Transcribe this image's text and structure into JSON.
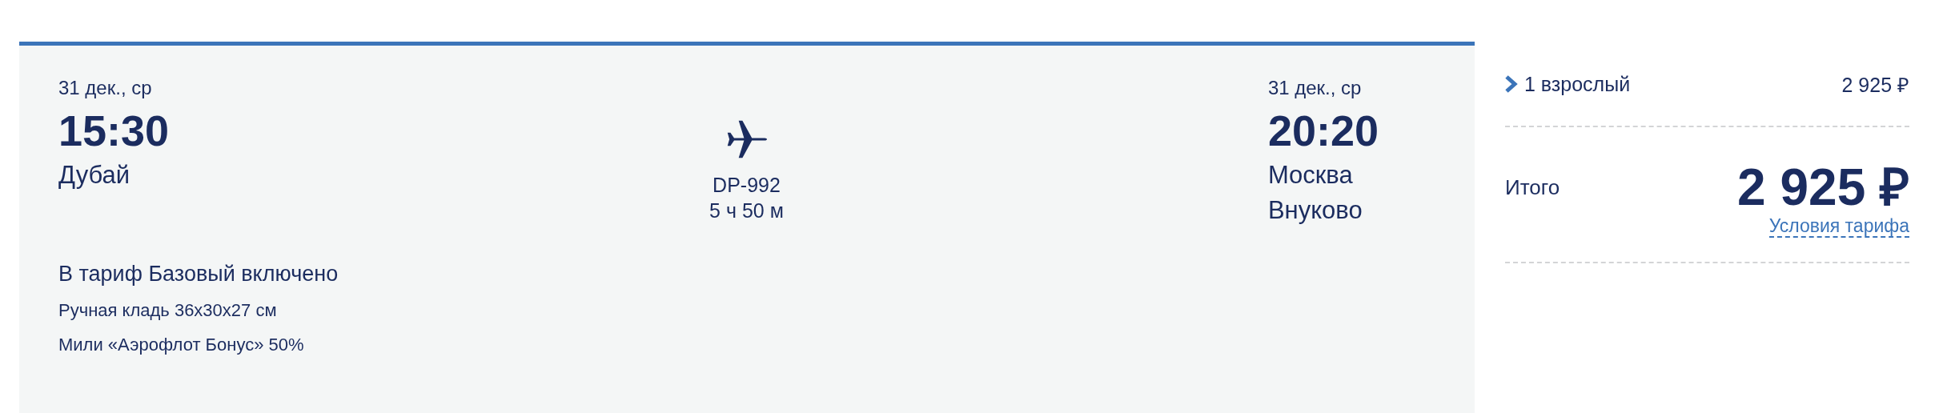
{
  "flight": {
    "departure": {
      "date": "31 дек., ср",
      "time": "15:30",
      "city": "Дубай"
    },
    "arrival": {
      "date": "31 дек., ср",
      "time": "20:20",
      "city": "Москва",
      "airport": "Внуково"
    },
    "flight_number": "DP-992",
    "duration": "5 ч 50 м"
  },
  "fare": {
    "title": "В тариф Базовый включено",
    "items": [
      "Ручная кладь 36x30x27 см",
      "Мили «Аэрофлот Бонус» 50%"
    ]
  },
  "summary": {
    "passengers": [
      {
        "label": "1 взрослый",
        "price": "2 925 ₽",
        "expanded": false
      }
    ],
    "total_label": "Итого",
    "total": "2 925 ₽",
    "link": "Условия тарифа"
  }
}
